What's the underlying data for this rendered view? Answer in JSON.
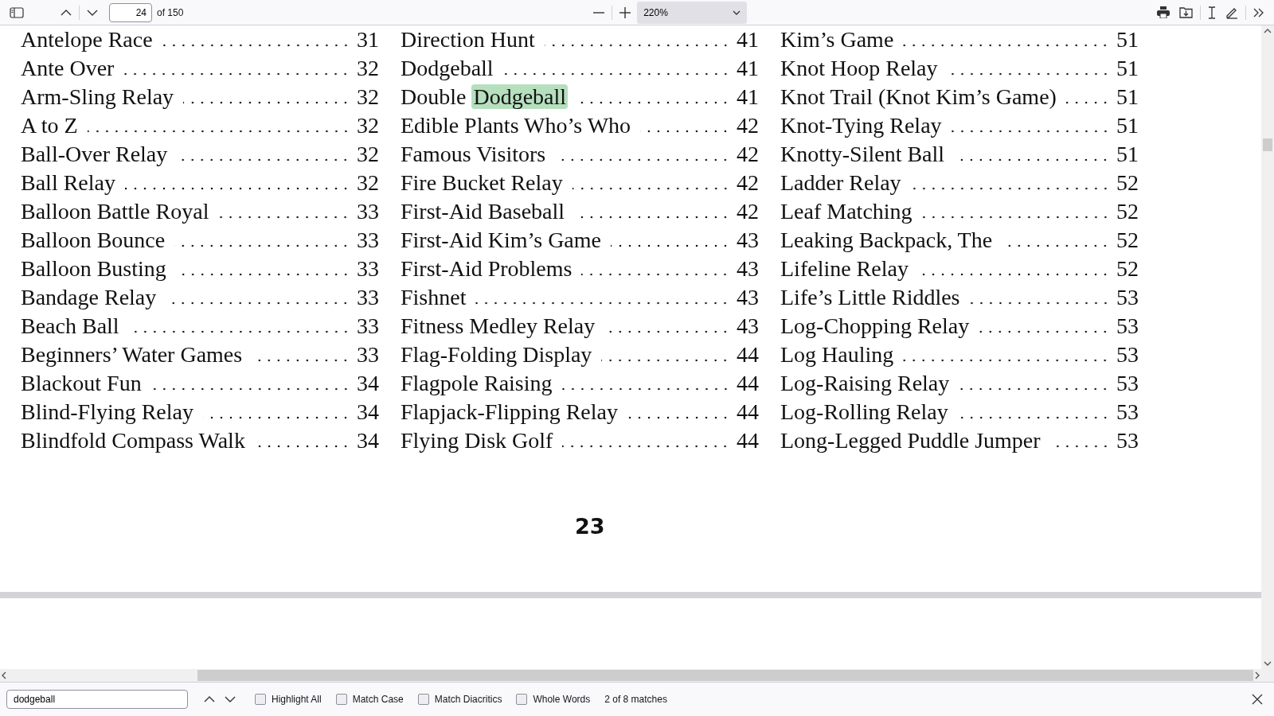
{
  "toolbar": {
    "page_number": "24",
    "page_count": "of 150",
    "zoom": "220%"
  },
  "index_columns": [
    [
      {
        "title": "Antelope Race",
        "page": "31"
      },
      {
        "title": "Ante Over",
        "page": "32"
      },
      {
        "title": "Arm-Sling Relay",
        "page": "32"
      },
      {
        "title": "A to Z",
        "page": "32"
      },
      {
        "title": "Ball-Over Relay",
        "page": "32"
      },
      {
        "title": "Ball Relay",
        "page": "32"
      },
      {
        "title": "Balloon Battle Royal",
        "page": "33"
      },
      {
        "title": "Balloon Bounce",
        "page": "33"
      },
      {
        "title": "Balloon Busting",
        "page": "33"
      },
      {
        "title": "Bandage Relay",
        "page": "33"
      },
      {
        "title": "Beach Ball",
        "page": "33"
      },
      {
        "title": "Beginners’ Water Games",
        "page": "33"
      },
      {
        "title": "Blackout Fun",
        "page": "34"
      },
      {
        "title": "Blind-Flying Relay",
        "page": "34"
      },
      {
        "title": "Blindfold Compass Walk",
        "page": "34"
      }
    ],
    [
      {
        "title": "Direction Hunt",
        "page": "41"
      },
      {
        "title": "Dodgeball",
        "page": "41"
      },
      {
        "title": "Double",
        "match": "Dodgeball",
        "page": "41"
      },
      {
        "title": "Edible Plants Who’s Who",
        "page": "42"
      },
      {
        "title": "Famous Visitors",
        "page": "42"
      },
      {
        "title": "Fire Bucket Relay",
        "page": "42"
      },
      {
        "title": "First-Aid Baseball",
        "page": "42"
      },
      {
        "title": "First-Aid Kim’s Game",
        "page": "43"
      },
      {
        "title": "First-Aid Problems",
        "page": "43"
      },
      {
        "title": "Fishnet",
        "page": "43"
      },
      {
        "title": "Fitness Medley Relay",
        "page": "43"
      },
      {
        "title": "Flag-Folding Display",
        "page": "44"
      },
      {
        "title": "Flagpole Raising",
        "page": "44"
      },
      {
        "title": "Flapjack-Flipping Relay",
        "page": "44"
      },
      {
        "title": "Flying Disk Golf",
        "page": "44"
      }
    ],
    [
      {
        "title": "Kim’s Game",
        "page": "51"
      },
      {
        "title": "Knot Hoop Relay",
        "page": "51"
      },
      {
        "title": "Knot Trail (Knot Kim’s Game)",
        "page": "51"
      },
      {
        "title": "Knot-Tying Relay",
        "page": "51"
      },
      {
        "title": "Knotty-Silent Ball",
        "page": "51"
      },
      {
        "title": "Ladder Relay",
        "page": "52"
      },
      {
        "title": "Leaf Matching",
        "page": "52"
      },
      {
        "title": "Leaking Backpack, The",
        "page": "52"
      },
      {
        "title": "Lifeline Relay",
        "page": "52"
      },
      {
        "title": "Life’s Little Riddles",
        "page": "53"
      },
      {
        "title": "Log-Chopping Relay",
        "page": "53"
      },
      {
        "title": "Log Hauling",
        "page": "53"
      },
      {
        "title": "Log-Raising Relay",
        "page": "53"
      },
      {
        "title": "Log-Rolling Relay",
        "page": "53"
      },
      {
        "title": "Long-Legged Puddle Jumper",
        "page": "53"
      }
    ]
  ],
  "page_footer": "23",
  "find_bar": {
    "query": "dodgeball",
    "options": [
      {
        "label": "Highlight All",
        "checked": false
      },
      {
        "label": "Match Case",
        "checked": false
      },
      {
        "label": "Match Diacritics",
        "checked": false
      },
      {
        "label": "Whole Words",
        "checked": false
      }
    ],
    "status": "2 of 8 matches"
  }
}
